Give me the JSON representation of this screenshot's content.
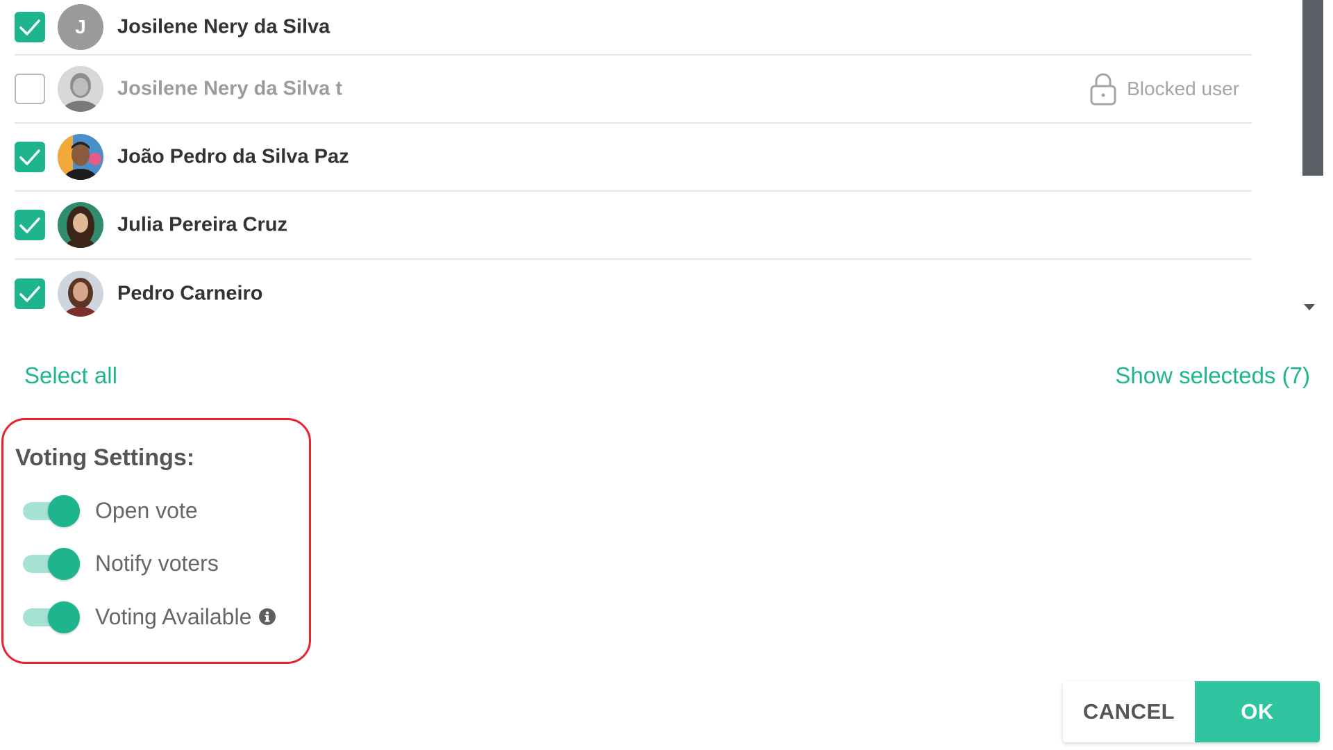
{
  "users": [
    {
      "name": "Josilene Nery da Silva",
      "checked": true,
      "blocked": false,
      "avatar_initial": "J",
      "avatar_type": "letter"
    },
    {
      "name": "Josilene Nery da Silva t",
      "checked": false,
      "blocked": true,
      "avatar_type": "photo-gray"
    },
    {
      "name": "João Pedro da Silva Paz",
      "checked": true,
      "blocked": false,
      "avatar_type": "photo"
    },
    {
      "name": "Julia Pereira Cruz",
      "checked": true,
      "blocked": false,
      "avatar_type": "photo"
    },
    {
      "name": "Pedro Carneiro",
      "checked": true,
      "blocked": false,
      "avatar_type": "photo"
    }
  ],
  "blocked_label": "Blocked user",
  "select_all_label": "Select all",
  "show_selected_label": "Show selecteds (7)",
  "voting_settings": {
    "title": "Voting Settings:",
    "options": [
      {
        "label": "Open vote",
        "enabled": true
      },
      {
        "label": "Notify voters",
        "enabled": true
      },
      {
        "label": "Voting Available",
        "enabled": true,
        "info_icon": "info-icon"
      }
    ]
  },
  "buttons": {
    "cancel": "CANCEL",
    "ok": "OK"
  },
  "colors": {
    "accent": "#1eb58e",
    "highlight_border": "#e8232d",
    "scrollbar": "#5b5f66"
  }
}
